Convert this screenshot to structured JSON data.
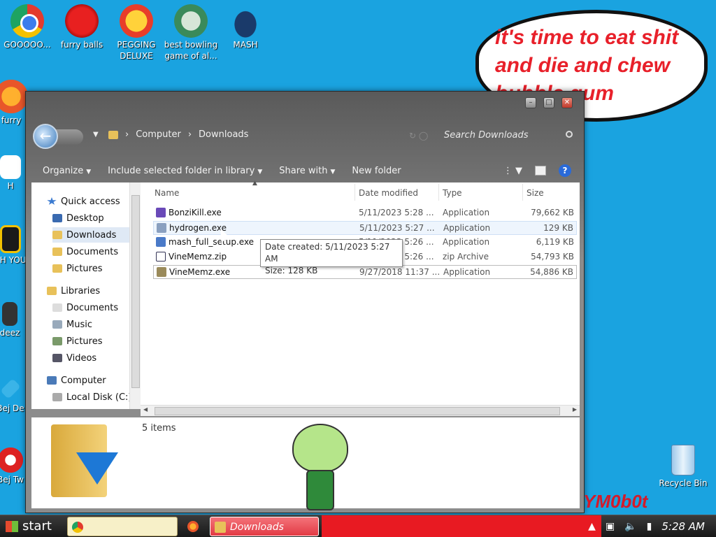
{
  "desktop_icons": [
    {
      "label": "GOOOOO...",
      "icon": "chrome-icon"
    },
    {
      "label": "furry balls",
      "icon": "furry-balls-icon"
    },
    {
      "label": "PEGGING DELUXE",
      "icon": "peggle-icon"
    },
    {
      "label": "best bowling game of al...",
      "icon": "bowling-game-icon"
    },
    {
      "label": "MASH",
      "icon": "mash-icon"
    }
  ],
  "left_icons_partial": [
    {
      "label": "furry",
      "icon": "firefox-icon"
    },
    {
      "label": "H",
      "icon": "h-app-icon"
    },
    {
      "label": "I H YOU",
      "icon": "i-h-you-icon"
    },
    {
      "label": "deez",
      "icon": "deez-icon"
    },
    {
      "label": "Bej De",
      "icon": "bejeweled-icon"
    },
    {
      "label": "Bej Tw",
      "icon": "bejeweled-twist-icon"
    }
  ],
  "speech_bubble": "it's time to eat shit and die and chew bubble gum",
  "window": {
    "breadcrumb": [
      "Computer",
      "Downloads"
    ],
    "search_placeholder": "Search Downloads",
    "toolbar": {
      "organize": "Organize",
      "include": "Include selected folder in library",
      "share": "Share with",
      "new_folder": "New folder"
    },
    "nav": {
      "quick_access": "Quick access",
      "quick_items": [
        "Desktop",
        "Downloads",
        "Documents",
        "Pictures"
      ],
      "libraries": "Libraries",
      "library_items": [
        "Documents",
        "Music",
        "Pictures",
        "Videos"
      ],
      "computer": "Computer",
      "computer_items": [
        "Local Disk (C:)"
      ]
    },
    "columns": {
      "name": "Name",
      "date": "Date modified",
      "type": "Type",
      "size": "Size"
    },
    "files": [
      {
        "name": "BonziKill.exe",
        "date": "5/11/2023 5:28 ...",
        "type": "Application",
        "size": "79,662 KB"
      },
      {
        "name": "hydrogen.exe",
        "date": "5/11/2023 5:27 ...",
        "type": "Application",
        "size": "129 KB"
      },
      {
        "name": "mash_full_setup.exe",
        "date": "5/11/2023 5:26 ...",
        "type": "Application",
        "size": "6,119 KB"
      },
      {
        "name": "VineMemz.zip",
        "date": "5/11/2023 5:26 ...",
        "type": "zip Archive",
        "size": "54,793 KB"
      },
      {
        "name": "VineMemz.exe",
        "date": "9/27/2018 11:37 ...",
        "type": "Application",
        "size": "54,886 KB"
      }
    ],
    "tooltip": {
      "created": "Date created: 5/11/2023 5:27 AM",
      "size": "Size: 128 KB"
    },
    "item_count": "5 items"
  },
  "recycle_bin": "Recycle Bin",
  "watermark": "YM0b0t",
  "taskbar": {
    "start": "start",
    "active_window": "Downloads",
    "clock": "5:28 AM"
  }
}
